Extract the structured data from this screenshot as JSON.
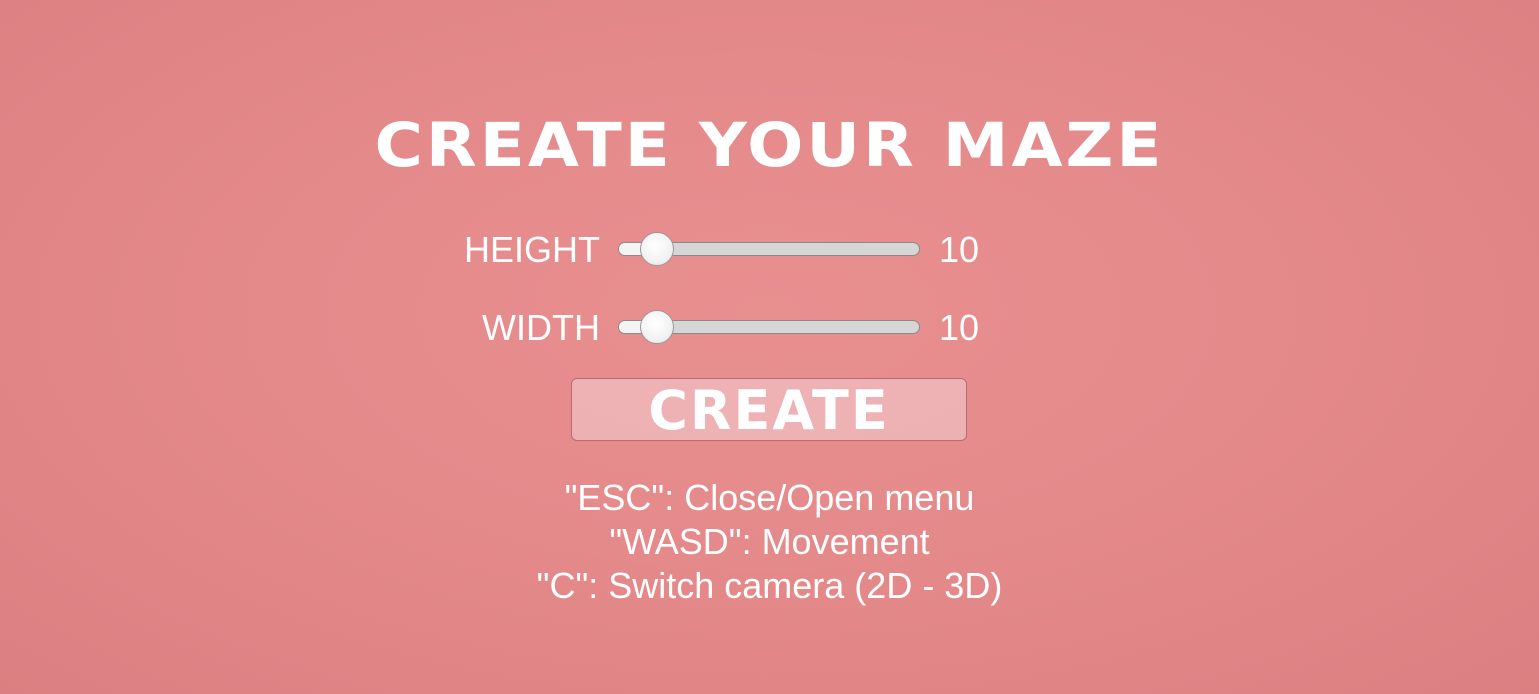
{
  "menu": {
    "title": "CREATE YOUR MAZE",
    "height_slider": {
      "label": "HEIGHT",
      "value": "10",
      "fraction": 0.125
    },
    "width_slider": {
      "label": "WIDTH",
      "value": "10",
      "fraction": 0.125
    },
    "create_button_label": "CREATE",
    "instructions": [
      "\"ESC\": Close/Open menu",
      "\"WASD\": Movement",
      "\"C\": Switch camera (2D - 3D)"
    ]
  },
  "colors": {
    "background": "#e58a8b",
    "text": "#ffffff",
    "slider_track": "#d6d6d6",
    "button_fill": "#edb1b3"
  }
}
